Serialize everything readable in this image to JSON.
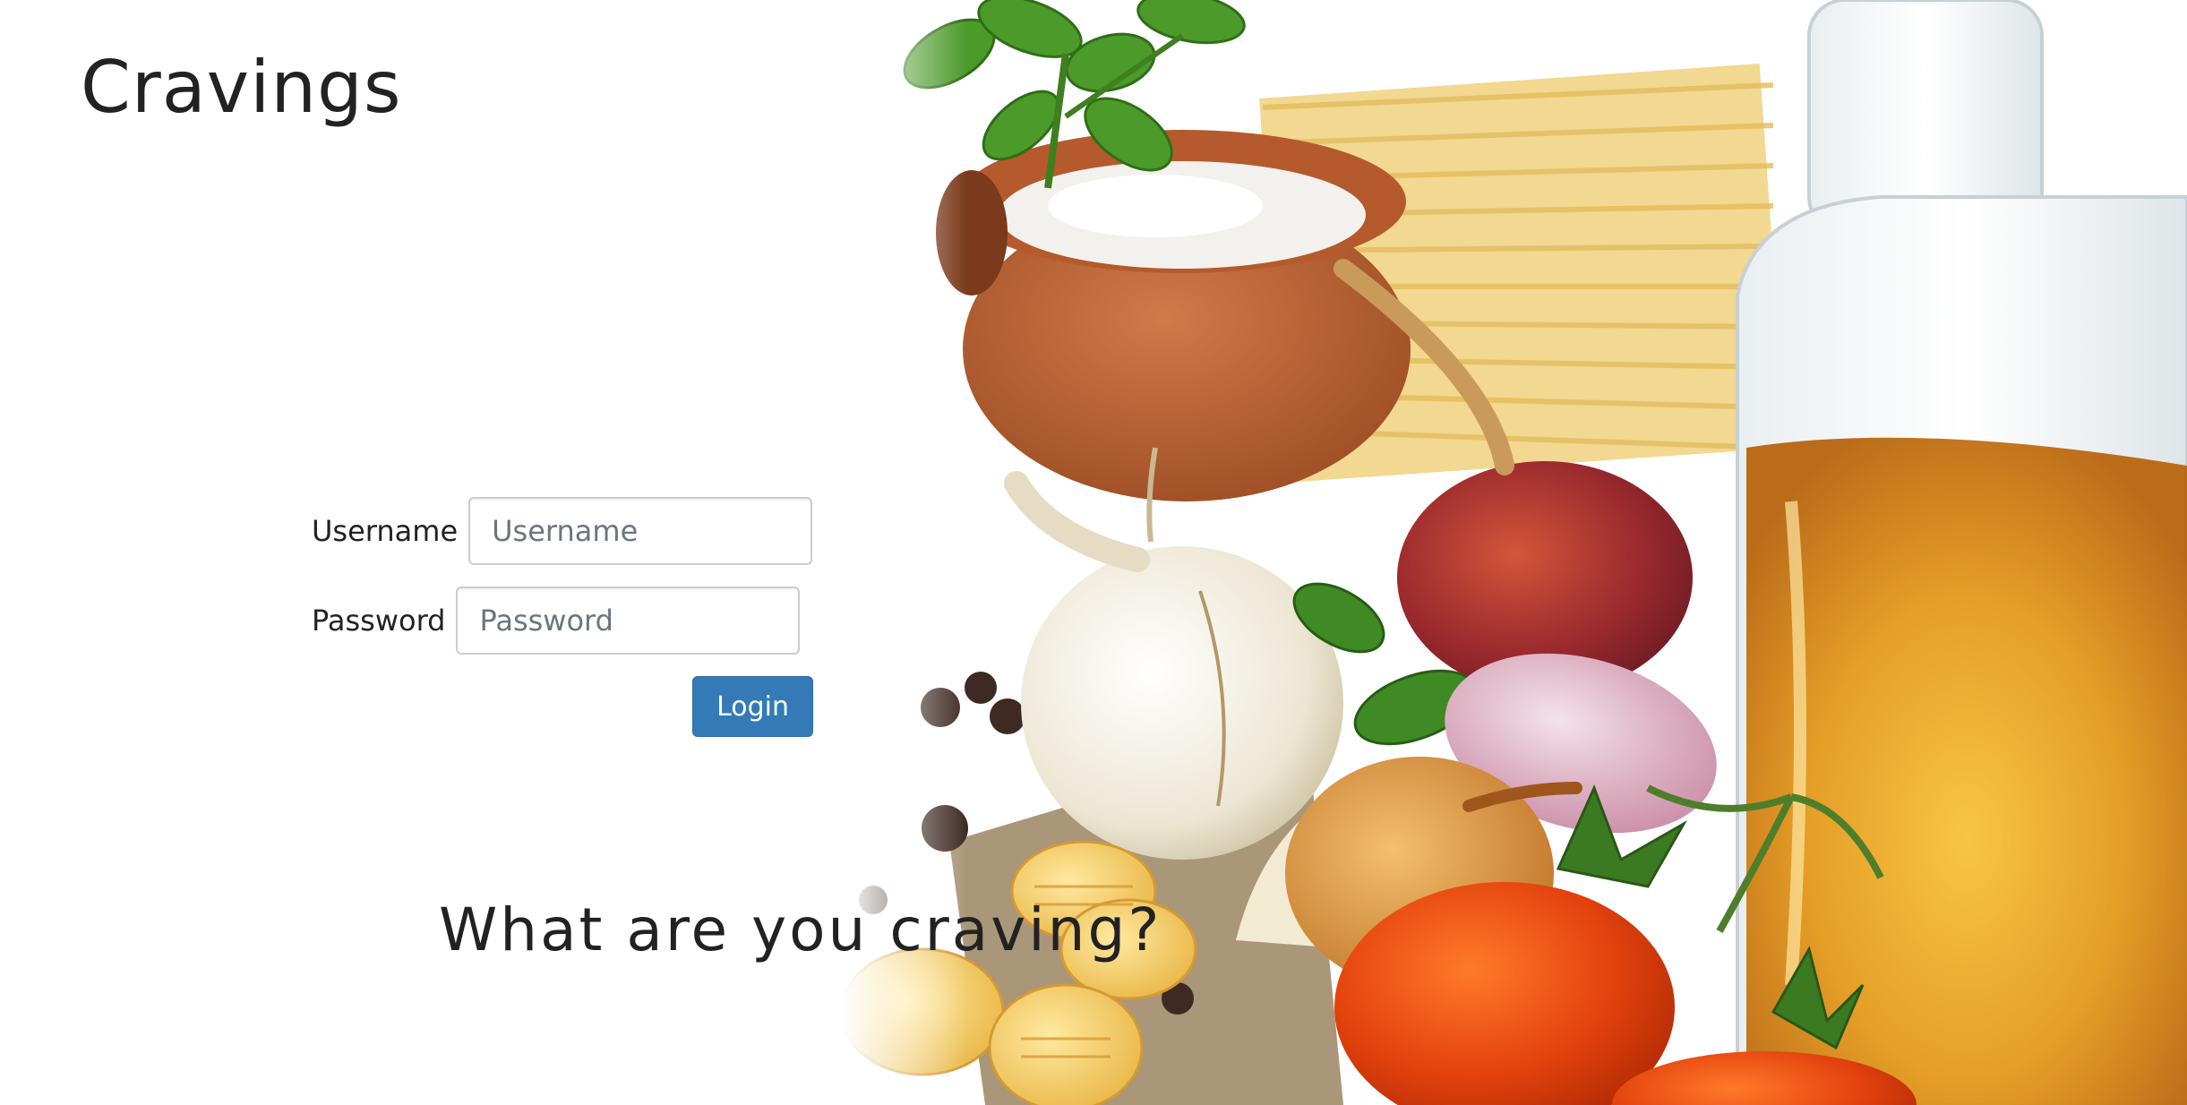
{
  "app": {
    "title": "Cravings"
  },
  "login": {
    "username_label": "Username",
    "username_placeholder": "Username",
    "username_value": "",
    "password_label": "Password",
    "password_placeholder": "Password",
    "password_value": "",
    "submit_label": "Login"
  },
  "tagline": "What are you craving?",
  "colors": {
    "primary_button": "#337ab7",
    "text": "#222222",
    "background": "#ffffff"
  },
  "hero_image": {
    "icon": "food-ingredients-illustration"
  }
}
